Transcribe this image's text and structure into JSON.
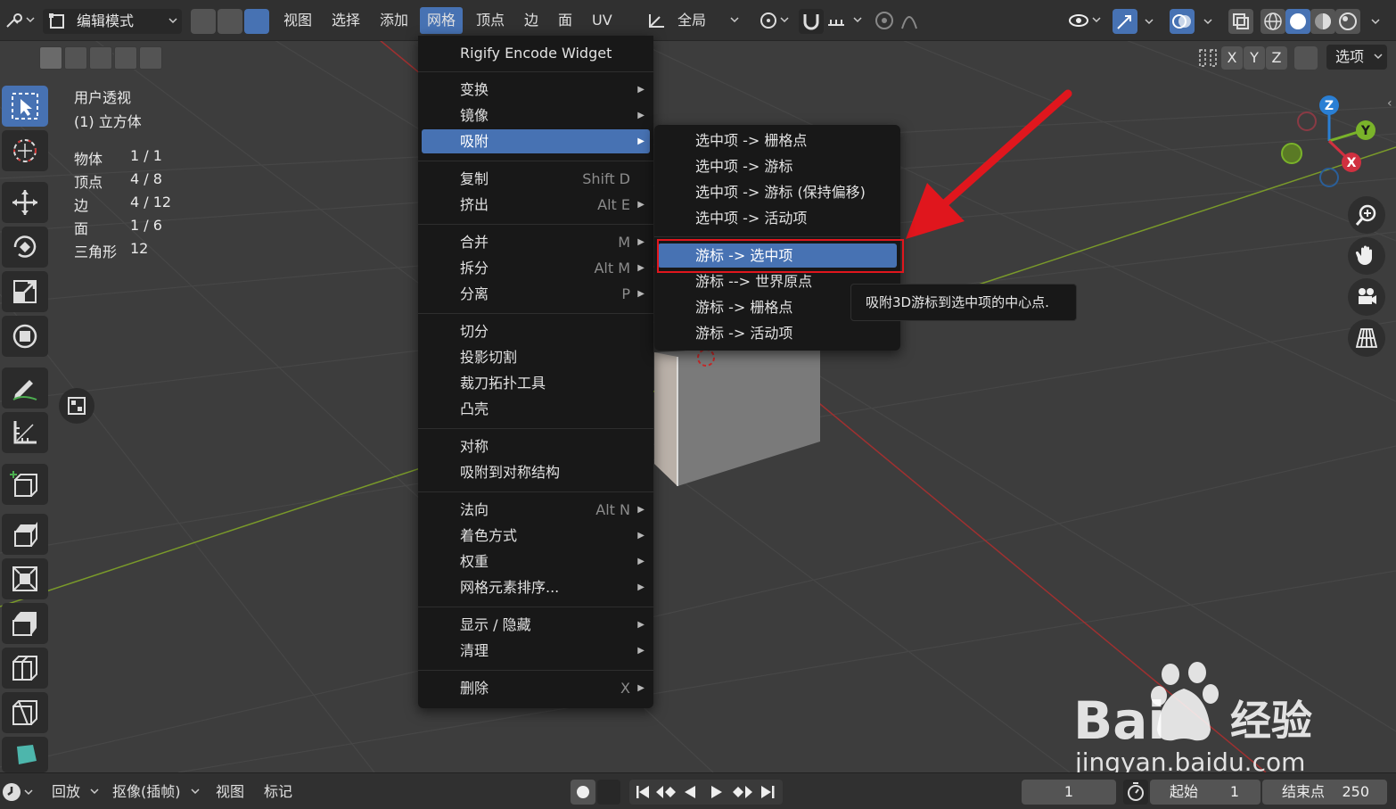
{
  "header": {
    "mode": "编辑模式",
    "menus": [
      "视图",
      "选择",
      "添加",
      "网格",
      "顶点",
      "边",
      "面",
      "UV"
    ],
    "active_menu": "网格",
    "orientation": "全局",
    "axes": [
      "X",
      "Y",
      "Z"
    ],
    "options_label": "选项"
  },
  "viewport": {
    "view_name": "用户透视",
    "object_name": "(1) 立方体",
    "stats": [
      {
        "label": "物体",
        "value": "1 / 1"
      },
      {
        "label": "顶点",
        "value": "4 / 8"
      },
      {
        "label": "边",
        "value": "4 / 12"
      },
      {
        "label": "面",
        "value": "1 / 6"
      },
      {
        "label": "三角形",
        "value": "12"
      }
    ],
    "gizmo": {
      "z": "Z",
      "y": "Y",
      "x": "X"
    }
  },
  "mesh_menu": {
    "items": [
      {
        "label": "Rigify Encode Widget",
        "shortcut": "",
        "submenu": false
      },
      {
        "label": "变换",
        "shortcut": "",
        "submenu": true
      },
      {
        "label": "镜像",
        "shortcut": "",
        "submenu": true
      },
      {
        "label": "吸附",
        "shortcut": "",
        "submenu": true
      },
      {
        "label": "复制",
        "shortcut": "Shift D",
        "submenu": false
      },
      {
        "label": "挤出",
        "shortcut": "Alt E",
        "submenu": true
      },
      {
        "label": "合并",
        "shortcut": "M",
        "submenu": true
      },
      {
        "label": "拆分",
        "shortcut": "Alt M",
        "submenu": true
      },
      {
        "label": "分离",
        "shortcut": "P",
        "submenu": true
      },
      {
        "label": "切分",
        "shortcut": "",
        "submenu": false
      },
      {
        "label": "投影切割",
        "shortcut": "",
        "submenu": false
      },
      {
        "label": "裁刀拓扑工具",
        "shortcut": "",
        "submenu": false
      },
      {
        "label": "凸壳",
        "shortcut": "",
        "submenu": false
      },
      {
        "label": "对称",
        "shortcut": "",
        "submenu": false
      },
      {
        "label": "吸附到对称结构",
        "shortcut": "",
        "submenu": false
      },
      {
        "label": "法向",
        "shortcut": "Alt N",
        "submenu": true
      },
      {
        "label": "着色方式",
        "shortcut": "",
        "submenu": true
      },
      {
        "label": "权重",
        "shortcut": "",
        "submenu": true
      },
      {
        "label": "网格元素排序...",
        "shortcut": "",
        "submenu": true
      },
      {
        "label": "显示 / 隐藏",
        "shortcut": "",
        "submenu": true
      },
      {
        "label": "清理",
        "shortcut": "",
        "submenu": true
      },
      {
        "label": "删除",
        "shortcut": "X",
        "submenu": true
      }
    ]
  },
  "snap_submenu": {
    "items": [
      "选中项 -> 栅格点",
      "选中项 -> 游标",
      "选中项 -> 游标 (保持偏移)",
      "选中项 -> 活动项",
      "游标 -> 选中项",
      "游标 --> 世界原点",
      "游标 -> 栅格点",
      "游标 -> 活动项"
    ],
    "highlighted": "游标 -> 选中项"
  },
  "tooltip": "吸附3D游标到选中项的中心点.",
  "timeline": {
    "menus": [
      "回放",
      "抠像(插帧)",
      "视图",
      "标记"
    ],
    "current_frame": "1",
    "start_label": "起始",
    "start_value": "1",
    "end_label": "结束点",
    "end_value": "250"
  },
  "watermark": {
    "brand": "Bai",
    "suffix": "经验",
    "url": "jingyan.baidu.com"
  },
  "colors": {
    "accent": "#4772b3",
    "red_arrow": "#e0161d",
    "axis_x": "#c0392b",
    "axis_y": "#6a9a1f"
  }
}
